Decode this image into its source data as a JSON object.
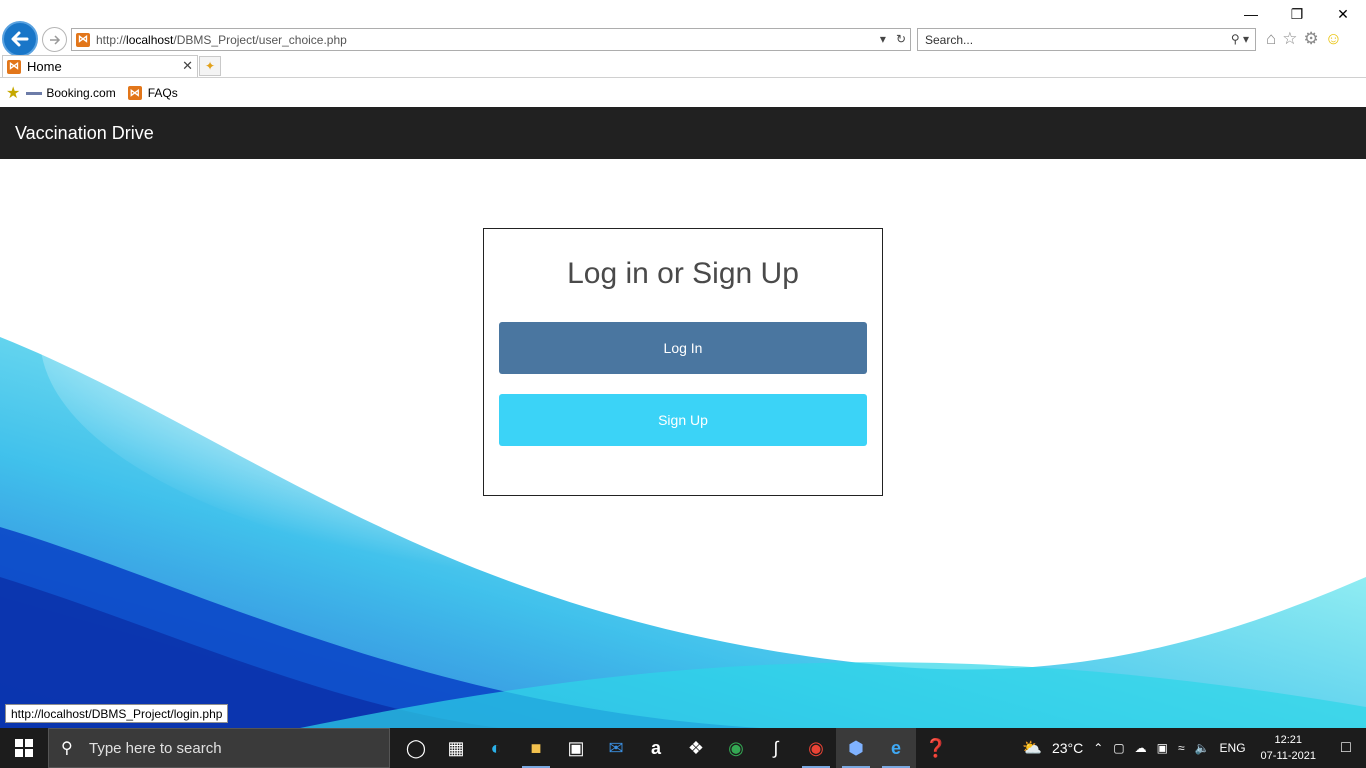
{
  "browser": {
    "address": {
      "prefix": "http://",
      "host": "localhost",
      "path": "/DBMS_Project/user_choice.php"
    },
    "search_placeholder": "Search...",
    "tab": {
      "title": "Home"
    },
    "favorites": [
      {
        "label": "Booking.com",
        "icon": "booking-icon"
      },
      {
        "label": "FAQs",
        "icon": "xampp-icon"
      }
    ],
    "status_url": "http://localhost/DBMS_Project/login.php"
  },
  "page": {
    "brand": "Vaccination Drive",
    "card": {
      "title": "Log in or Sign Up",
      "login_label": "Log In",
      "signup_label": "Sign Up"
    },
    "colors": {
      "navbar": "#212121",
      "login_button": "#4a76a0",
      "signup_button": "#3bd3f7"
    }
  },
  "taskbar": {
    "search_placeholder": "Type here to search",
    "weather": "23°C",
    "language": "ENG",
    "time": "12:21",
    "date": "07-11-2021",
    "apps": [
      "cortana-icon",
      "task-view-icon",
      "edge-icon",
      "file-explorer-icon",
      "store-icon",
      "mail-icon",
      "amazon-icon",
      "dropbox-icon",
      "chrome-icon",
      "sublime-icon",
      "chrome-profile-icon",
      "virtualbox-icon",
      "internet-explorer-icon",
      "help-icon"
    ]
  }
}
